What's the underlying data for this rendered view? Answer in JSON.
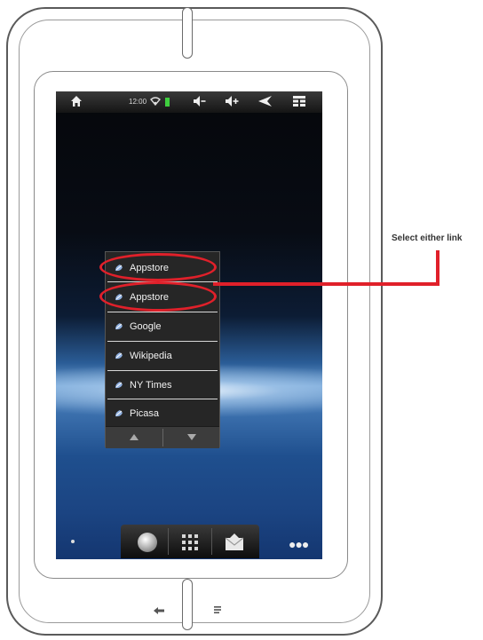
{
  "status_bar": {
    "clock": "12:00",
    "icons": [
      "home-icon",
      "wifi-icon",
      "battery-icon",
      "volume-down-icon",
      "volume-up-icon",
      "back-icon",
      "menu-icon"
    ]
  },
  "bookmarks": {
    "items": [
      {
        "label": "Appstore",
        "highlighted": true
      },
      {
        "label": "Appstore",
        "highlighted": true
      },
      {
        "label": "Google",
        "highlighted": false
      },
      {
        "label": "Wikipedia",
        "highlighted": false
      },
      {
        "label": "NY Times",
        "highlighted": false
      },
      {
        "label": "Picasa",
        "highlighted": false
      }
    ],
    "nav": [
      "page-up-arrow",
      "page-down-arrow"
    ]
  },
  "dock": {
    "items": [
      "browser-icon",
      "app-drawer-icon",
      "email-icon"
    ]
  },
  "callout": {
    "text": "Select either link"
  },
  "colors": {
    "annotation": "#e0202a",
    "popup_bg": "#262626",
    "status_bar": "#1c1c1c"
  }
}
